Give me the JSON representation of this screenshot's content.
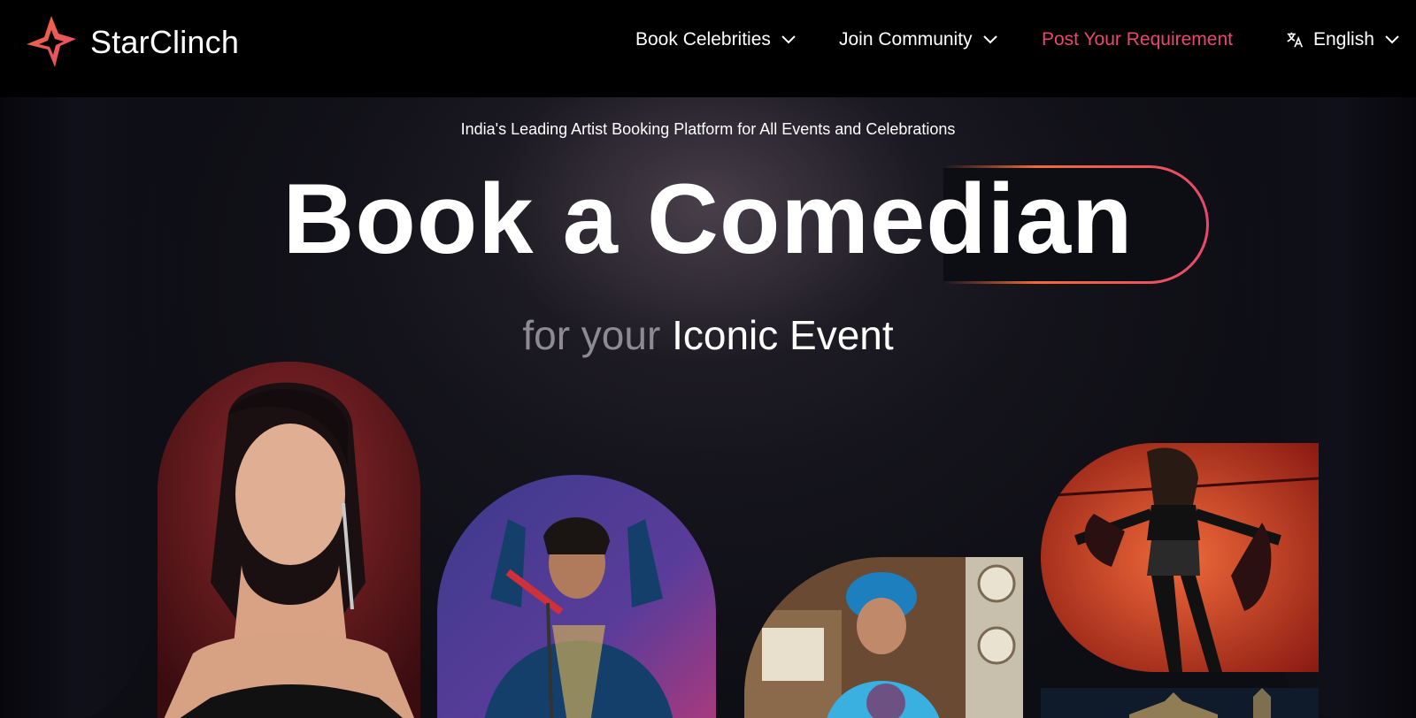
{
  "brand": {
    "name": "StarClinch",
    "colors": {
      "accent": "#e8486f",
      "orange": "#f06b3c"
    }
  },
  "nav": {
    "book_celebrities": "Book Celebrities",
    "join_community": "Join Community",
    "post_requirement": "Post Your Requirement",
    "language": "English"
  },
  "hero": {
    "tagline": "India's Leading Artist Booking Platform for All Events and Celebrations",
    "headline": "Book a Comedian",
    "sub_muted": "for your",
    "sub_strong": "Iconic Event"
  },
  "icons": {
    "logo": "starclinch-star-icon",
    "dropdown": "chevron-down-icon",
    "language": "translate-icon"
  },
  "images": [
    {
      "name": "celebrity-photo-woman-earrings"
    },
    {
      "name": "performer-photo-singer-microphone"
    },
    {
      "name": "performer-photo-turban-man"
    },
    {
      "name": "performer-photo-dancer-stage"
    },
    {
      "name": "venue-photo-night-building"
    }
  ]
}
